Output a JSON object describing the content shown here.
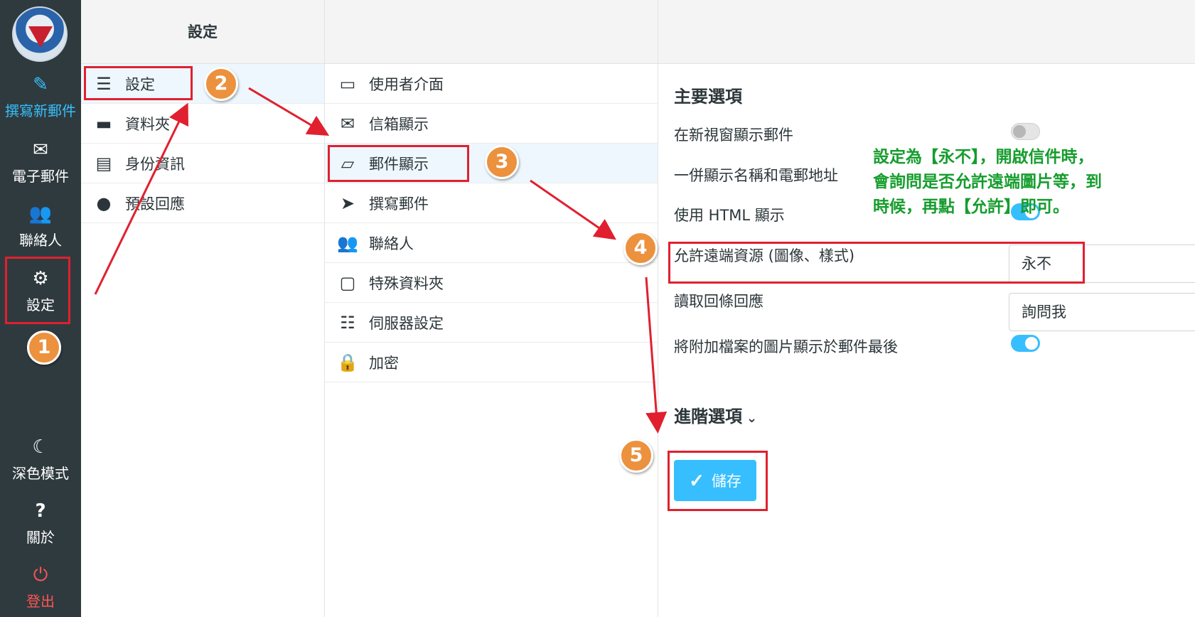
{
  "taskbar": {
    "compose": {
      "label": "撰寫新郵件",
      "icon": "compose-icon"
    },
    "mail": {
      "label": "電子郵件",
      "icon": "envelope-icon"
    },
    "contacts": {
      "label": "聯絡人",
      "icon": "users-icon"
    },
    "settings": {
      "label": "設定",
      "icon": "gear-icon"
    },
    "darkmode": {
      "label": "深色模式",
      "icon": "moon-icon"
    },
    "about": {
      "label": "關於",
      "icon": "question-icon"
    },
    "logout": {
      "label": "登出",
      "icon": "power-icon"
    }
  },
  "settings_column": {
    "header": "設定",
    "items": [
      {
        "label": "設定",
        "icon": "sliders-icon"
      },
      {
        "label": "資料夾",
        "icon": "folder-icon"
      },
      {
        "label": "身份資訊",
        "icon": "id-card-icon"
      },
      {
        "label": "預設回應",
        "icon": "comment-icon"
      }
    ]
  },
  "sections_column": {
    "items": [
      {
        "label": "使用者介面",
        "icon": "monitor-icon"
      },
      {
        "label": "信箱顯示",
        "icon": "envelope-icon"
      },
      {
        "label": "郵件顯示",
        "icon": "inbox-icon"
      },
      {
        "label": "撰寫郵件",
        "icon": "paper-plane-icon"
      },
      {
        "label": "聯絡人",
        "icon": "users-icon"
      },
      {
        "label": "特殊資料夾",
        "icon": "folder-outline-icon"
      },
      {
        "label": "伺服器設定",
        "icon": "server-icon"
      },
      {
        "label": "加密",
        "icon": "lock-icon"
      }
    ]
  },
  "prefs": {
    "main_title": "主要選項",
    "open_new_window": {
      "label": "在新視窗顯示郵件",
      "enabled": false
    },
    "show_name_email": {
      "label": "一併顯示名稱和電郵地址"
    },
    "html_display": {
      "label": "使用 HTML 顯示"
    },
    "remote_resources": {
      "label": "允許遠端資源 (圖像、樣式)",
      "value": "永不"
    },
    "read_receipt": {
      "label": "讀取回條回應",
      "value": "詢問我"
    },
    "attach_images": {
      "label": "將附加檔案的圖片顯示於郵件最後",
      "enabled": true
    },
    "advanced_label": "進階選項",
    "save_label": "儲存"
  },
  "annotations": {
    "badges": [
      "1",
      "2",
      "3",
      "4",
      "5"
    ],
    "note_lines": [
      "設定為【永不】，開啟信件時，",
      "會詢問是否允許遠端圖片等，到",
      "時候，再點【允許】即可。"
    ],
    "highlight_color": "#e0202f",
    "badge_color": "#ec913e",
    "note_color": "#169d2d"
  }
}
